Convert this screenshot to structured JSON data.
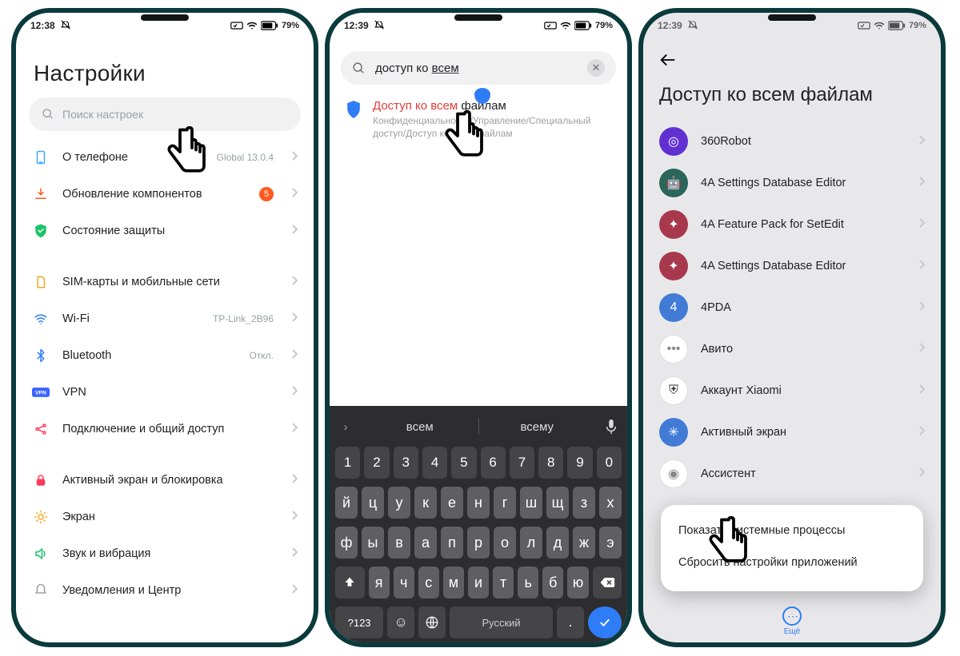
{
  "status": {
    "time1": "12:38",
    "time2": "12:39",
    "time3": "12:39",
    "battery": "79%"
  },
  "phone1": {
    "title": "Настройки",
    "search_placeholder": "Поиск настроек",
    "items": [
      {
        "label": "О телефоне",
        "extra": "Global 13.0.4",
        "icon": "phone"
      },
      {
        "label": "Обновление компонентов",
        "badge": "5",
        "icon": "update"
      },
      {
        "label": "Состояние защиты",
        "icon": "shield"
      }
    ],
    "items2": [
      {
        "label": "SIM-карты и мобильные сети",
        "icon": "sim"
      },
      {
        "label": "Wi-Fi",
        "extra": "TP-Link_2B96",
        "icon": "wifi"
      },
      {
        "label": "Bluetooth",
        "extra": "Откл.",
        "icon": "bt"
      },
      {
        "label": "VPN",
        "icon": "vpn"
      },
      {
        "label": "Подключение и общий доступ",
        "icon": "share"
      }
    ],
    "items3": [
      {
        "label": "Активный экран и блокировка",
        "icon": "lock"
      },
      {
        "label": "Экран",
        "icon": "sun"
      },
      {
        "label": "Звук и вибрация",
        "icon": "sound"
      },
      {
        "label": "Уведомления и Центр",
        "icon": "notif"
      }
    ]
  },
  "phone2": {
    "search_value_plain": "доступ ко ",
    "search_value_underlined": "всем",
    "result_title_hl": "Доступ ко всем",
    "result_title_rest": " файлам",
    "result_path": "Конфиденциальность/Управление/Специальный доступ/Доступ ко всем файлам",
    "suggestions": [
      "всем",
      "всему"
    ],
    "keyboard": {
      "row_num": [
        "1",
        "2",
        "3",
        "4",
        "5",
        "6",
        "7",
        "8",
        "9",
        "0"
      ],
      "row1": [
        "й",
        "ц",
        "у",
        "к",
        "е",
        "н",
        "г",
        "ш",
        "щ",
        "з",
        "х"
      ],
      "row2": [
        "ф",
        "ы",
        "в",
        "а",
        "п",
        "р",
        "о",
        "л",
        "д",
        "ж",
        "э"
      ],
      "row3": [
        "я",
        "ч",
        "с",
        "м",
        "и",
        "т",
        "ь",
        "б",
        "ю"
      ],
      "bottom": {
        "sym": "?123",
        "lang": "Русский"
      }
    }
  },
  "phone3": {
    "title": "Доступ ко всем файлам",
    "apps": [
      "360Robot",
      "4A Settings Database Editor",
      "4A Feature Pack for SetEdit",
      "4A Settings Database Editor",
      "4PDA",
      "Авито",
      "Аккаунт Xiaomi",
      "Активный экран",
      "Ассистент"
    ],
    "popup": {
      "opt1": "Показать системные процессы",
      "opt2": "Сбросить настройки приложений"
    },
    "more_label": "Ещё"
  }
}
